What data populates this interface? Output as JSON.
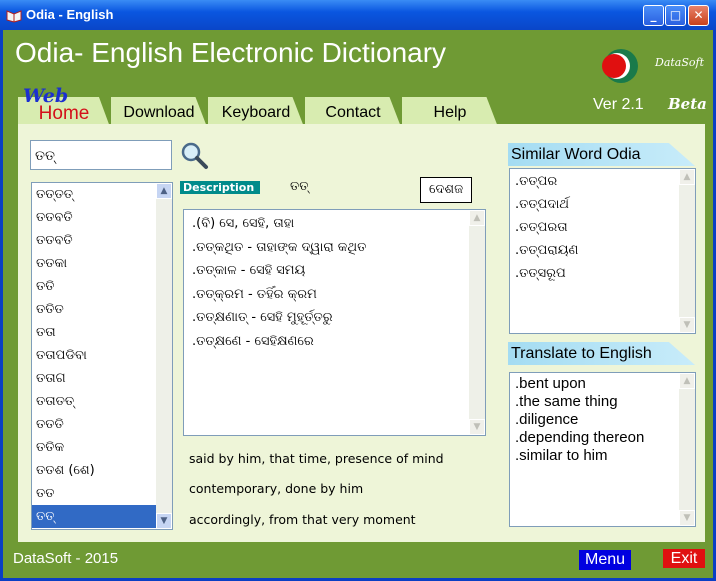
{
  "window": {
    "title": "Odia - English",
    "icon": "book-icon",
    "controls": [
      "minimize-icon",
      "maximize-icon",
      "close-icon"
    ]
  },
  "header": {
    "title": "Odia- English Electronic Dictionary",
    "logo_text": "DataSoft",
    "version": "Ver 2.1",
    "beta": "Beta",
    "web_label": "Web"
  },
  "tabs": [
    {
      "label": "Home"
    },
    {
      "label": "Download"
    },
    {
      "label": "Keyboard"
    },
    {
      "label": "Contact"
    },
    {
      "label": "Help"
    }
  ],
  "search": {
    "value": "ତତ୍",
    "button_icon": "magnifier-icon"
  },
  "word_list": {
    "items": [
      "ତତ୍‌ତତ୍",
      "ତତବତି",
      "ତତବତି",
      "ତତକା",
      "ତତି",
      "ତତିତ",
      "ତତା",
      "ତତାପଡିବା",
      "ତତାଗ",
      "ତତାତତ୍",
      "ତତତି",
      "ତତିକ",
      "ତତଶ (ଶେ)",
      "ତତ",
      "ତତ୍"
    ],
    "selected_index": 14
  },
  "description": {
    "label": "Description",
    "word": "ତତ୍",
    "part_of_speech": "ଦେଶଜ",
    "lines": [
      ".(ବି) ସେ, ସେହି, ତାହା",
      ".ତତ୍‌କଥିତ - ତାହାଙ୍କ ଦ୍ୱାରା କଥିତ",
      ".ତତ୍‌କାଳ - ସେହି ସମୟ",
      ".ତତ୍‌କ୍ରମ - ତହିଁର କ୍ରମ",
      ".ତତ୍‌କ୍ଷଣାତ୍ - ସେହି ମୁହୂର୍ତ୍ତରୁ",
      ".ତତ୍‌କ୍ଷଣେ - ସେହିକ୍ଷଣରେ"
    ],
    "english_lines": [
      "said by him, that time, presence of mind",
      "contemporary, done by him",
      "accordingly, from that very moment"
    ]
  },
  "similar": {
    "heading": "Similar Word Odia",
    "items": [
      ".ତତ୍ପର",
      ".ତତ୍ପଦାର୍ଥ",
      ".ତତ୍ପରତା",
      ".ତତ୍ପରାୟଣ",
      ".ତତ୍ସରୂପ"
    ]
  },
  "translate": {
    "heading": "Translate to English",
    "items": [
      ".bent upon",
      ".the same thing",
      ".diligence",
      ".depending thereon",
      ".similar to him"
    ]
  },
  "footer": {
    "text": "DataSoft - 2015",
    "menu": "Menu",
    "exit": "Exit"
  }
}
